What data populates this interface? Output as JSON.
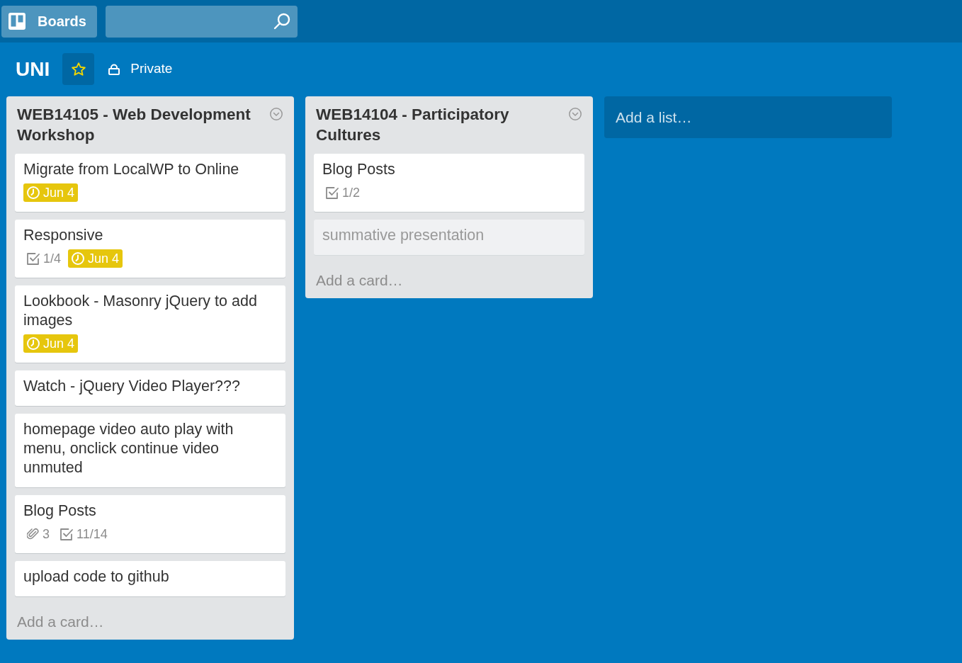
{
  "top_bar": {
    "boards_button": {
      "label": "Boards"
    }
  },
  "board": {
    "title": "UNI",
    "starred": true,
    "visibility": "Private"
  },
  "lists": [
    {
      "title": "WEB14105 - Web Development Workshop",
      "cards": [
        {
          "title": "Migrate from LocalWP to Online",
          "faded": false,
          "badges": [
            {
              "kind": "due",
              "text": "Jun 4"
            }
          ]
        },
        {
          "title": "Responsive",
          "faded": false,
          "badges": [
            {
              "kind": "checklist",
              "text": "1/4"
            },
            {
              "kind": "due",
              "text": "Jun 4"
            }
          ]
        },
        {
          "title": "Lookbook - Masonry jQuery to add images",
          "faded": false,
          "badges": [
            {
              "kind": "due",
              "text": "Jun 4"
            }
          ]
        },
        {
          "title": "Watch - jQuery Video Player???",
          "faded": false
        },
        {
          "title": "homepage video auto play with menu, onclick continue video unmuted",
          "faded": false
        },
        {
          "title": "Blog Posts",
          "faded": false,
          "badges": [
            {
              "kind": "attachments",
              "text": "3"
            },
            {
              "kind": "checklist",
              "text": "11/14"
            }
          ]
        },
        {
          "title": "upload code to github",
          "faded": false
        }
      ],
      "add_card": "Add a card…"
    },
    {
      "title": "WEB14104 - Participatory Cultures",
      "cards": [
        {
          "title": "Blog Posts",
          "faded": false,
          "badges": [
            {
              "kind": "checklist",
              "text": "1/2"
            }
          ]
        },
        {
          "title": "summative presentation",
          "faded": true
        }
      ],
      "add_card": "Add a card…"
    }
  ],
  "add_list": "Add a list…"
}
